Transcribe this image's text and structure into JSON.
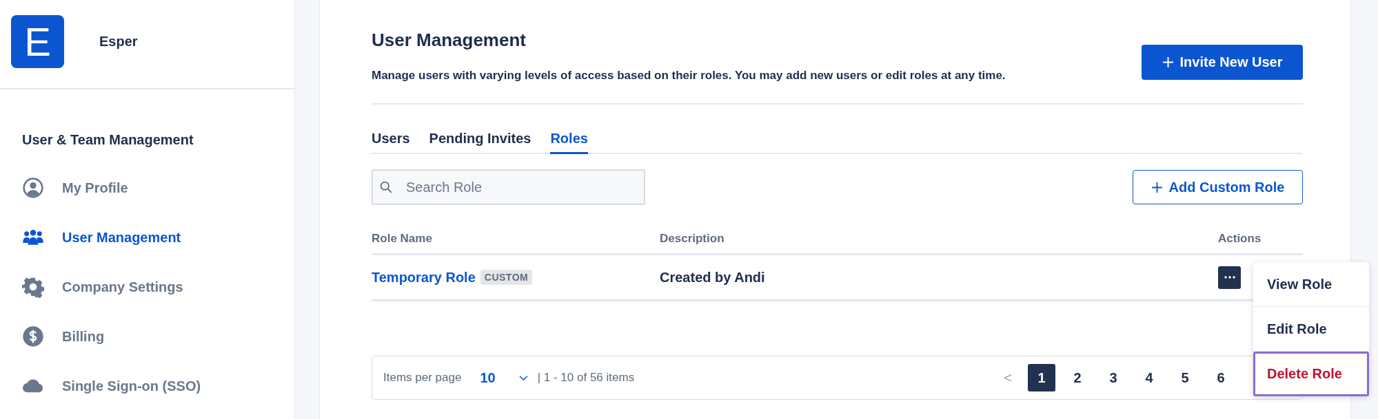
{
  "sidebar": {
    "logo_letter": "E",
    "org_name": "Esper",
    "section_title": "User & Team Management",
    "items": [
      {
        "label": "My Profile",
        "kind": "profile",
        "selected": false
      },
      {
        "label": "User Management",
        "kind": "users",
        "selected": true
      },
      {
        "label": "Company Settings",
        "kind": "gear",
        "selected": false
      },
      {
        "label": "Billing",
        "kind": "dollar",
        "selected": false
      },
      {
        "label": "Single Sign-on (SSO)",
        "kind": "cloud",
        "selected": false
      }
    ]
  },
  "main": {
    "title": "User Management",
    "description": "Manage users with varying levels of access based on their roles. You may add new users or edit roles at any time.",
    "invite_button": "Invite New User",
    "tabs": [
      {
        "label": "Users",
        "selected": false
      },
      {
        "label": "Pending Invites",
        "selected": false
      },
      {
        "label": "Roles",
        "selected": true
      }
    ],
    "search": {
      "placeholder": "Search Role"
    },
    "add_button": "Add Custom Role",
    "table": {
      "columns": [
        "Role Name",
        "Description",
        "Actions"
      ],
      "rows": [
        {
          "name": "Temporary Role",
          "tag": "CUSTOM",
          "description": "Created by Andi"
        }
      ]
    },
    "pagination": {
      "items_per_page_label": "Items per page",
      "page_size": "10",
      "range": "| 1 - 10 of 56 items",
      "prev": "<",
      "pages": [
        {
          "label": "1",
          "selected": true
        },
        {
          "label": "2",
          "selected": false
        },
        {
          "label": "3",
          "selected": false
        },
        {
          "label": "4",
          "selected": false
        },
        {
          "label": "5",
          "selected": false
        },
        {
          "label": "6",
          "selected": false
        }
      ]
    },
    "action_menu": {
      "items": [
        {
          "label": "View Role",
          "kind": "normal",
          "focused": false
        },
        {
          "label": "Edit Role",
          "kind": "normal",
          "focused": false
        },
        {
          "label": "Delete Role",
          "kind": "danger",
          "focused": true
        }
      ]
    }
  }
}
